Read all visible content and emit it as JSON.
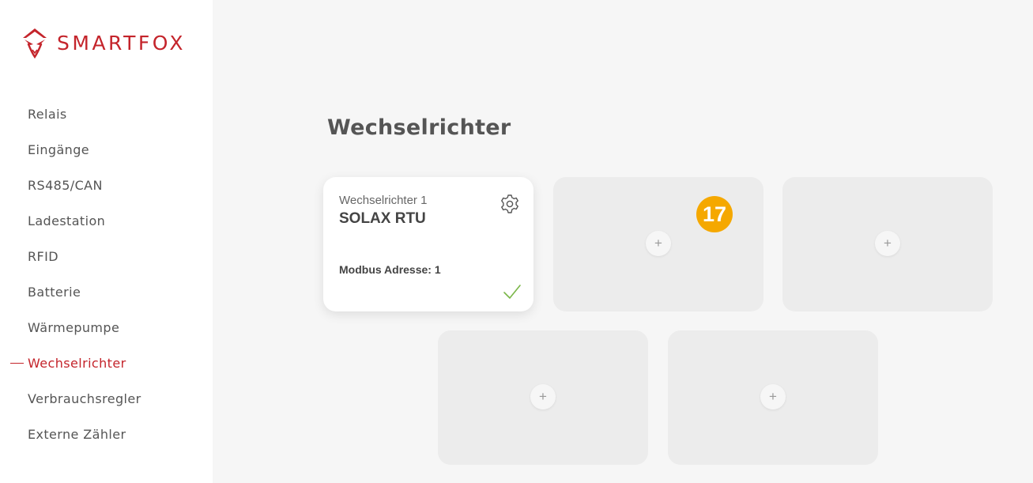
{
  "brand": {
    "name": "SMARTFOX",
    "accent_color": "#c4242b"
  },
  "nav": {
    "items": [
      {
        "label": "Relais",
        "active": false
      },
      {
        "label": "Eingänge",
        "active": false
      },
      {
        "label": "RS485/CAN",
        "active": false
      },
      {
        "label": "Ladestation",
        "active": false
      },
      {
        "label": "RFID",
        "active": false
      },
      {
        "label": "Batterie",
        "active": false
      },
      {
        "label": "Wärmepumpe",
        "active": false
      },
      {
        "label": "Wechselrichter",
        "active": true
      },
      {
        "label": "Verbrauchsregler",
        "active": false
      },
      {
        "label": "Externe Zähler",
        "active": false
      }
    ]
  },
  "page": {
    "title": "Wechselrichter"
  },
  "cards": [
    {
      "type": "configured",
      "subtitle": "Wechselrichter 1",
      "name": "SOLAX RTU",
      "address": "Modbus Adresse: 1",
      "status": "ok",
      "status_color": "#7ab648",
      "settings_icon": "gear-icon"
    },
    {
      "type": "empty",
      "action_label": "+"
    },
    {
      "type": "empty",
      "action_label": "+"
    },
    {
      "type": "empty",
      "action_label": "+"
    },
    {
      "type": "empty",
      "action_label": "+"
    }
  ],
  "badge": {
    "value": "17",
    "color": "#f5a800"
  }
}
